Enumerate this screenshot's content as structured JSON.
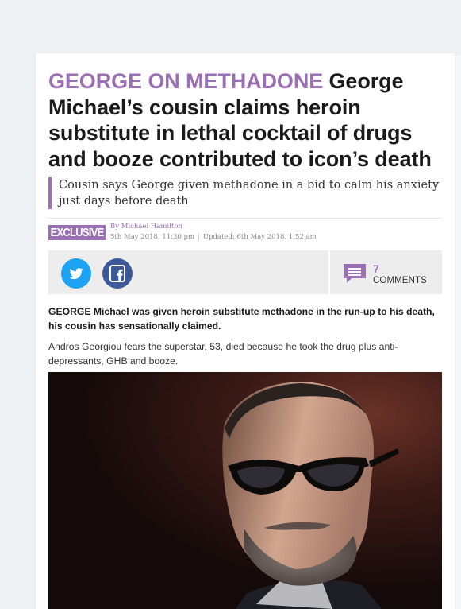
{
  "article": {
    "kicker": "GEORGE ON METHADONE",
    "headline": "George Michael’s cousin claims heroin substitute in lethal cocktail of drugs and booze contributed to icon’s death",
    "standfirst": "Cousin says George given methadone in a bid to calm his anxiety just days before death",
    "badge": "EXCLUSIVE",
    "byline": "By Michael Hamilton",
    "published": "5th May 2018, 11:30 pm",
    "updated": "Updated: 6th May 2018, 1:52 am",
    "lead": "GEORGE Michael was given heroin substitute methadone in the run-up to his death, his cousin has sensationally claimed.",
    "paragraph": "Andros Georgiou fears the superstar, 53, died because he took the drug plus anti-depressants, GHB and booze."
  },
  "share": {
    "icons": [
      "twitter-icon",
      "facebook-icon"
    ],
    "comments_count": "7",
    "comments_label": "COMMENTS"
  },
  "colors": {
    "accent": "#9b6fb5",
    "twitter": "#1da1f2",
    "facebook": "#3b5998",
    "share_bar": "#ededed"
  }
}
